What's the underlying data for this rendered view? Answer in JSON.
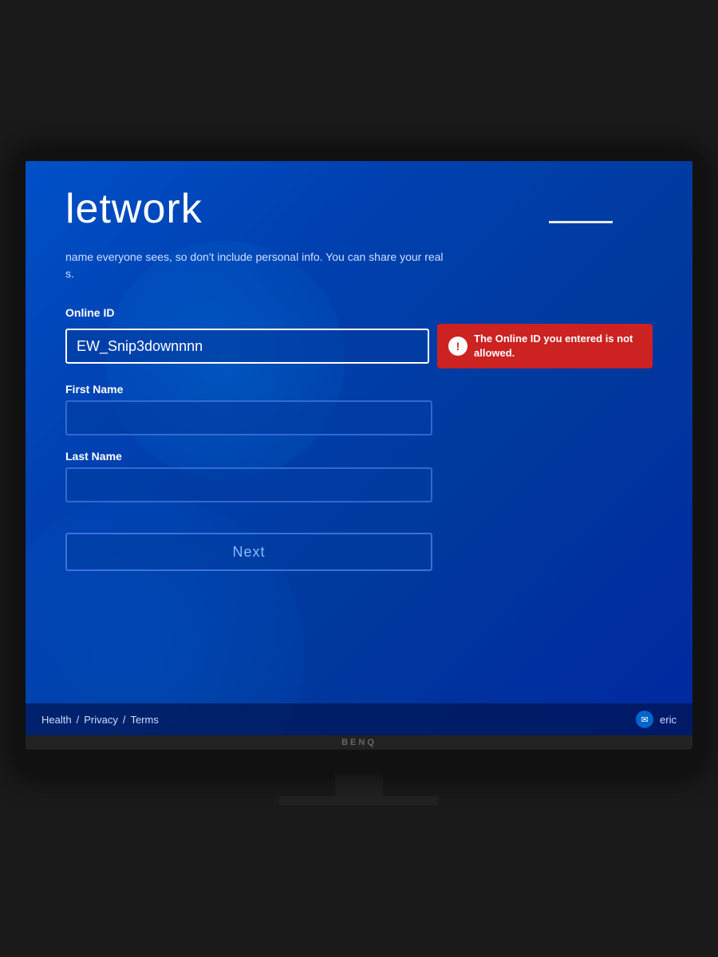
{
  "page": {
    "title": "Network",
    "title_partial": "letwork",
    "divider_text": "——————",
    "subtitle_line1": "name everyone sees, so don't include personal info. You can share your real",
    "subtitle_line2": "s."
  },
  "form": {
    "online_id_label": "Online ID",
    "online_id_value": "EW_Snip3downnnn",
    "online_id_placeholder": "",
    "first_name_label": "First Name",
    "first_name_value": "",
    "first_name_placeholder": "",
    "last_name_label": "Last Name",
    "last_name_value": "",
    "last_name_placeholder": "",
    "next_button_label": "Next"
  },
  "error": {
    "icon": "!",
    "message": "The Online ID you entered is not allowed."
  },
  "footer": {
    "health_label": "Health",
    "privacy_label": "Privacy",
    "terms_label": "Terms",
    "separator": "/",
    "user_icon": "✉",
    "user_name": "eric"
  },
  "monitor": {
    "brand": "BenQ"
  }
}
